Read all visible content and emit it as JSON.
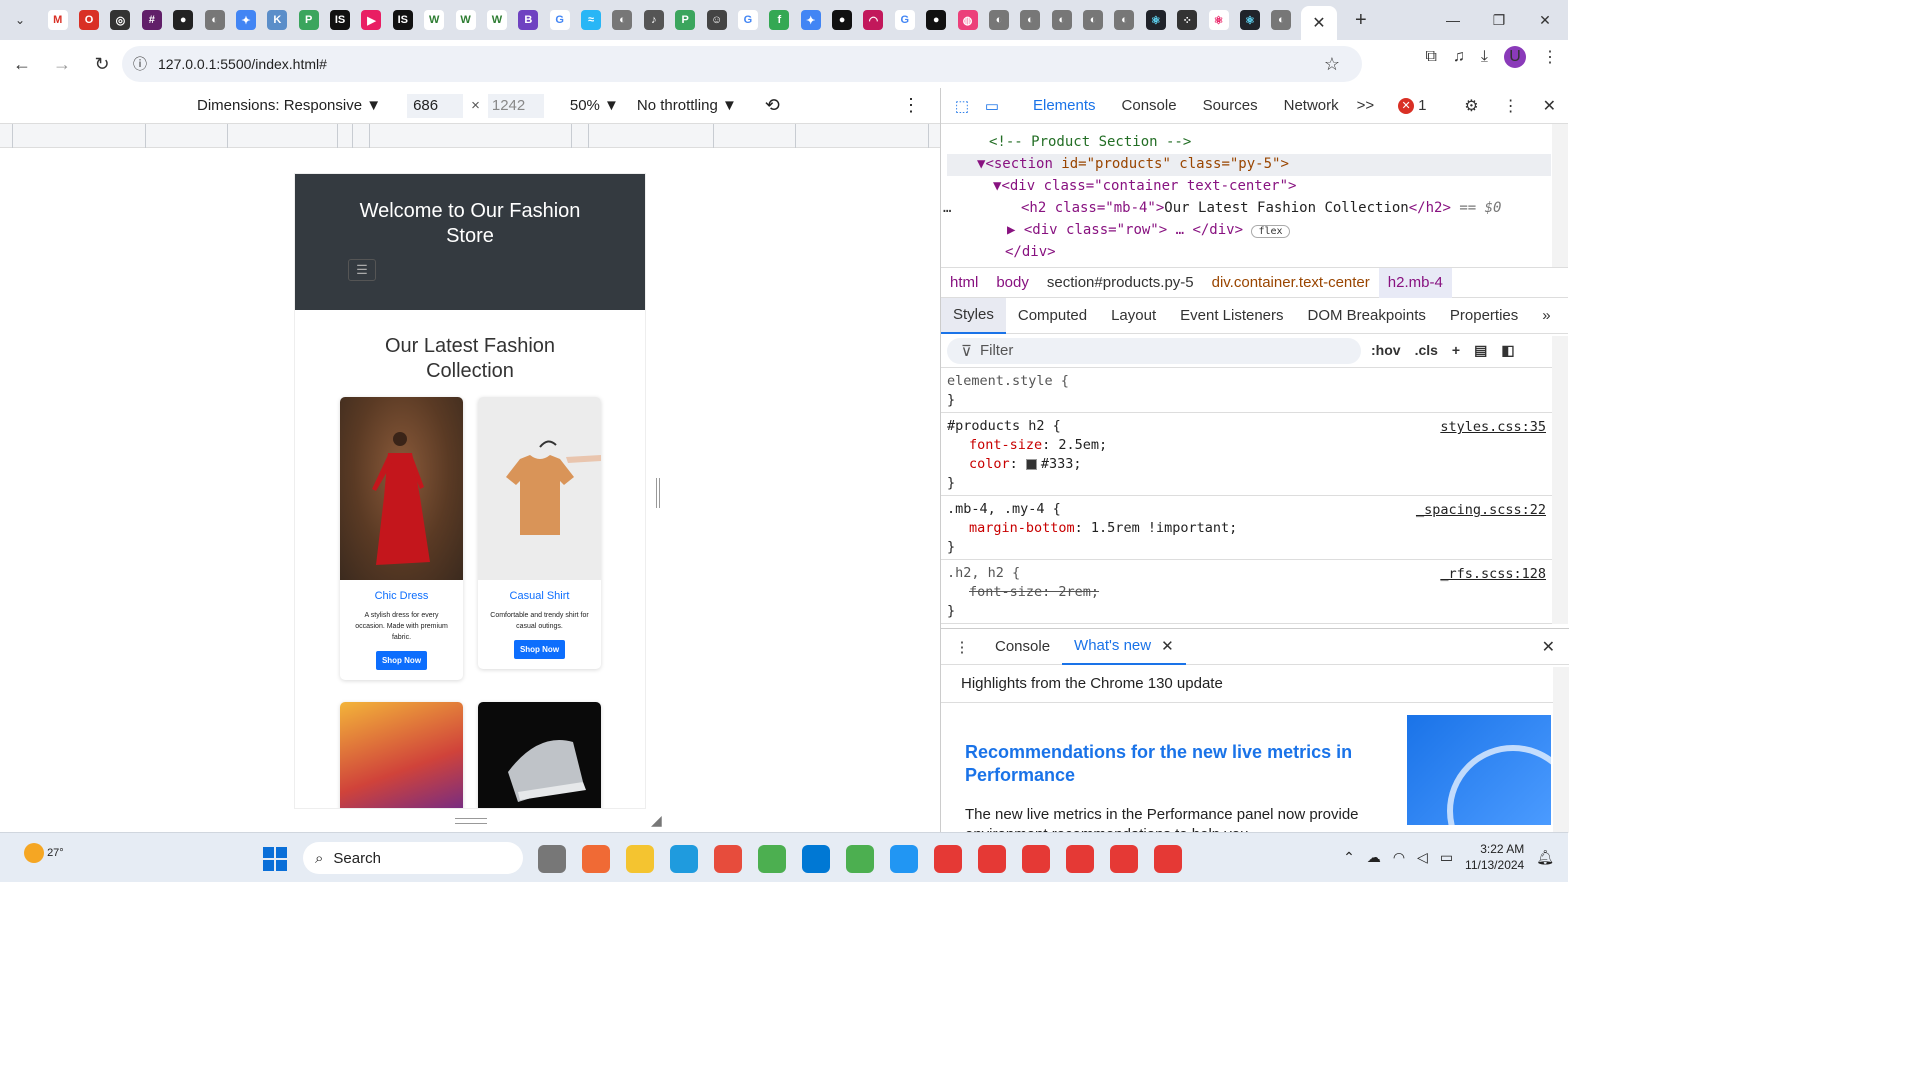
{
  "browser": {
    "url": "127.0.0.1:5500/index.html#",
    "tab_close": "✕",
    "new_tab": "+",
    "profile_initial": "U"
  },
  "device_toolbar": {
    "dimensions": "Dimensions: Responsive ▼",
    "width": "686",
    "times": "×",
    "height": "1242",
    "zoom": "50% ▼",
    "throttling": "No throttling ▼"
  },
  "page": {
    "hero_title": "Welcome to Our Fashion Store",
    "section_title": "Our Latest Fashion Collection",
    "products": [
      {
        "name": "Chic Dress",
        "desc": "A stylish dress for every occasion. Made with premium fabric.",
        "button": "Shop Now"
      },
      {
        "name": "Casual Shirt",
        "desc": "Comfortable and trendy shirt for casual outings.",
        "button": "Shop Now"
      }
    ]
  },
  "devtools": {
    "tabs": [
      "Elements",
      "Console",
      "Sources",
      "Network"
    ],
    "more": ">>",
    "error_count": "1",
    "dom": {
      "comment": "<!-- Product Section -->",
      "section_tag": "<section ",
      "section_attrs": "id=\"products\" class=\"py-5\">",
      "div_container": "<div class=\"container text-center\">",
      "h2_open": "<h2 class=\"mb-4\">",
      "h2_text": "Our Latest Fashion Collection",
      "h2_close": "</h2>",
      "h2_ref": "== $0",
      "div_row": "<div class=\"row\"> … </div>",
      "flex_badge": "flex",
      "div_close": "</div>"
    },
    "breadcrumbs": [
      "html",
      "body",
      "section#products.py-5",
      "div.container.text-center",
      "h2.mb-4"
    ],
    "subtabs": [
      "Styles",
      "Computed",
      "Layout",
      "Event Listeners",
      "DOM Breakpoints",
      "Properties"
    ],
    "filter_placeholder": "Filter",
    "hov": ":hov",
    "cls": ".cls",
    "rules": {
      "element_style": "element.style {",
      "close": "}",
      "r1_selector": "#products h2 {",
      "r1_source": "styles.css:35",
      "r1_p1_name": "font-size",
      "r1_p1_value": ": 2.5em;",
      "r1_p2_name": "color",
      "r1_p2_value": "#333;",
      "r2_selector": ".mb-4, .my-4 {",
      "r2_source": "_spacing.scss:22",
      "r2_p1_name": "margin-bottom",
      "r2_p1_value": ": 1.5rem !important;",
      "r3_selector": ".h2, h2 {",
      "r3_source": "_rfs.scss:128",
      "r3_p1": "font-size: 2rem;"
    },
    "drawer": {
      "tabs": [
        "Console",
        "What's new"
      ],
      "highlights": "Highlights from the Chrome 130 update",
      "news_title": "Recommendations for the new live metrics in Performance",
      "news_body": "The new live metrics in the Performance panel now provide environment recommendations to help you"
    }
  },
  "taskbar": {
    "weather": "27°",
    "search": "Search",
    "time": "3:22 AM",
    "date": "11/13/2024"
  }
}
